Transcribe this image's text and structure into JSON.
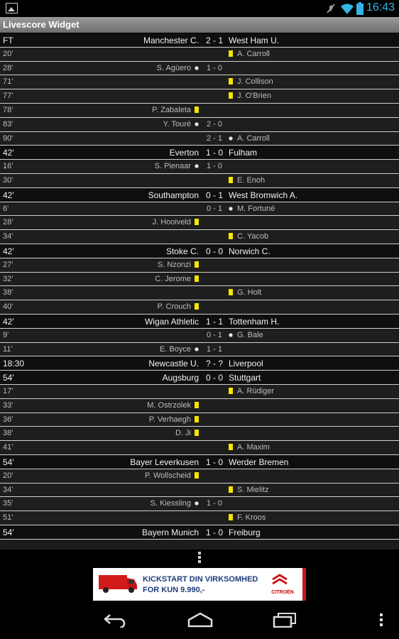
{
  "status_bar": {
    "time": "16:43",
    "icons": [
      "image-icon",
      "signal-off-icon",
      "wifi-icon",
      "battery-icon"
    ]
  },
  "app": {
    "title": "Livescore Widget"
  },
  "colors": {
    "card": "#f5e500",
    "accent": "#33b5e5",
    "title_bar": "#8a8a8a"
  },
  "rows": [
    {
      "type": "match",
      "minute": "FT",
      "home": "Manchester C.",
      "score": "2 - 1",
      "away": "West Ham U."
    },
    {
      "type": "event",
      "minute": "20'",
      "home": "",
      "home_icon": "",
      "score": "",
      "away": "A. Carroll",
      "away_icon": "yellow-card"
    },
    {
      "type": "event",
      "minute": "28'",
      "home": "S. Agüero",
      "home_icon": "goal",
      "score": "1 - 0",
      "away": "",
      "away_icon": ""
    },
    {
      "type": "event",
      "minute": "71'",
      "home": "",
      "home_icon": "",
      "score": "",
      "away": "J. Collison",
      "away_icon": "yellow-card"
    },
    {
      "type": "event",
      "minute": "77'",
      "home": "",
      "home_icon": "",
      "score": "",
      "away": "J. O'Brien",
      "away_icon": "yellow-card"
    },
    {
      "type": "event",
      "minute": "78'",
      "home": "P. Zabaleta",
      "home_icon": "yellow-card",
      "score": "",
      "away": "",
      "away_icon": ""
    },
    {
      "type": "event",
      "minute": "83'",
      "home": "Y. Touré",
      "home_icon": "goal",
      "score": "2 - 0",
      "away": "",
      "away_icon": ""
    },
    {
      "type": "event",
      "minute": "90'",
      "home": "",
      "home_icon": "",
      "score": "2 - 1",
      "away": "A. Carroll",
      "away_icon": "goal"
    },
    {
      "type": "match",
      "minute": "42'",
      "home": "Everton",
      "score": "1 - 0",
      "away": "Fulham"
    },
    {
      "type": "event",
      "minute": "16'",
      "home": "S. Pienaar",
      "home_icon": "goal",
      "score": "1 - 0",
      "away": "",
      "away_icon": ""
    },
    {
      "type": "event",
      "minute": "30'",
      "home": "",
      "home_icon": "",
      "score": "",
      "away": "E. Enoh",
      "away_icon": "yellow-card"
    },
    {
      "type": "match",
      "minute": "42'",
      "home": "Southampton",
      "score": "0 - 1",
      "away": "West Bromwich A."
    },
    {
      "type": "event",
      "minute": "6'",
      "home": "",
      "home_icon": "",
      "score": "0 - 1",
      "away": "M. Fortuné",
      "away_icon": "goal"
    },
    {
      "type": "event",
      "minute": "28'",
      "home": "J. Hooiveld",
      "home_icon": "yellow-card",
      "score": "",
      "away": "",
      "away_icon": ""
    },
    {
      "type": "event",
      "minute": "34'",
      "home": "",
      "home_icon": "",
      "score": "",
      "away": "C. Yacob",
      "away_icon": "yellow-card"
    },
    {
      "type": "match",
      "minute": "42'",
      "home": "Stoke C.",
      "score": "0 - 0",
      "away": "Norwich C."
    },
    {
      "type": "event",
      "minute": "27'",
      "home": "S. Nzonzi",
      "home_icon": "yellow-card",
      "score": "",
      "away": "",
      "away_icon": ""
    },
    {
      "type": "event",
      "minute": "32'",
      "home": "C. Jerome",
      "home_icon": "yellow-card",
      "score": "",
      "away": "",
      "away_icon": ""
    },
    {
      "type": "event",
      "minute": "38'",
      "home": "",
      "home_icon": "",
      "score": "",
      "away": "G. Holt",
      "away_icon": "yellow-card"
    },
    {
      "type": "event",
      "minute": "40'",
      "home": "P. Crouch",
      "home_icon": "yellow-card",
      "score": "",
      "away": "",
      "away_icon": ""
    },
    {
      "type": "match",
      "minute": "42'",
      "home": "Wigan Athletic",
      "score": "1 - 1",
      "away": "Tottenham H."
    },
    {
      "type": "event",
      "minute": "9'",
      "home": "",
      "home_icon": "",
      "score": "0 - 1",
      "away": "G. Bale",
      "away_icon": "goal"
    },
    {
      "type": "event",
      "minute": "11'",
      "home": "E. Boyce",
      "home_icon": "goal",
      "score": "1 - 1",
      "away": "",
      "away_icon": ""
    },
    {
      "type": "match",
      "minute": "18:30",
      "home": "Newcastle U.",
      "score": "? - ?",
      "away": "Liverpool"
    },
    {
      "type": "match",
      "minute": "54'",
      "home": "Augsburg",
      "score": "0 - 0",
      "away": "Stuttgart"
    },
    {
      "type": "event",
      "minute": "17'",
      "home": "",
      "home_icon": "",
      "score": "",
      "away": "A. Rüdiger",
      "away_icon": "yellow-card"
    },
    {
      "type": "event",
      "minute": "33'",
      "home": "M. Ostrzolek",
      "home_icon": "yellow-card",
      "score": "",
      "away": "",
      "away_icon": ""
    },
    {
      "type": "event",
      "minute": "36'",
      "home": "P. Verhaegh",
      "home_icon": "yellow-card",
      "score": "",
      "away": "",
      "away_icon": ""
    },
    {
      "type": "event",
      "minute": "38'",
      "home": "D. Ji",
      "home_icon": "yellow-card",
      "score": "",
      "away": "",
      "away_icon": ""
    },
    {
      "type": "event",
      "minute": "41'",
      "home": "",
      "home_icon": "",
      "score": "",
      "away": "A. Maxim",
      "away_icon": "yellow-card"
    },
    {
      "type": "match",
      "minute": "54'",
      "home": "Bayer Leverkusen",
      "score": "1 - 0",
      "away": "Werder Bremen"
    },
    {
      "type": "event",
      "minute": "20'",
      "home": "P. Wollscheid",
      "home_icon": "yellow-card",
      "score": "",
      "away": "",
      "away_icon": ""
    },
    {
      "type": "event",
      "minute": "34'",
      "home": "",
      "home_icon": "",
      "score": "",
      "away": "S. Mielitz",
      "away_icon": "yellow-card"
    },
    {
      "type": "event",
      "minute": "35'",
      "home": "S. Kiessling",
      "home_icon": "goal",
      "score": "1 - 0",
      "away": "",
      "away_icon": ""
    },
    {
      "type": "event",
      "minute": "51'",
      "home": "",
      "home_icon": "",
      "score": "",
      "away": "F. Kroos",
      "away_icon": "yellow-card"
    },
    {
      "type": "match",
      "minute": "54'",
      "home": "Bayern Munich",
      "score": "1 - 0",
      "away": "Freiburg"
    }
  ],
  "more_menu": {
    "icon": "overflow-menu-icon"
  },
  "ad": {
    "line1": "KICKSTART DIN VIRKSOMHED",
    "line2": "FOR KUN 9.990,-",
    "brand": "CITROËN",
    "icon": "van-icon"
  },
  "nav_bar": {
    "icons": [
      "back-icon",
      "home-icon",
      "recent-apps-icon",
      "menu-icon"
    ]
  }
}
